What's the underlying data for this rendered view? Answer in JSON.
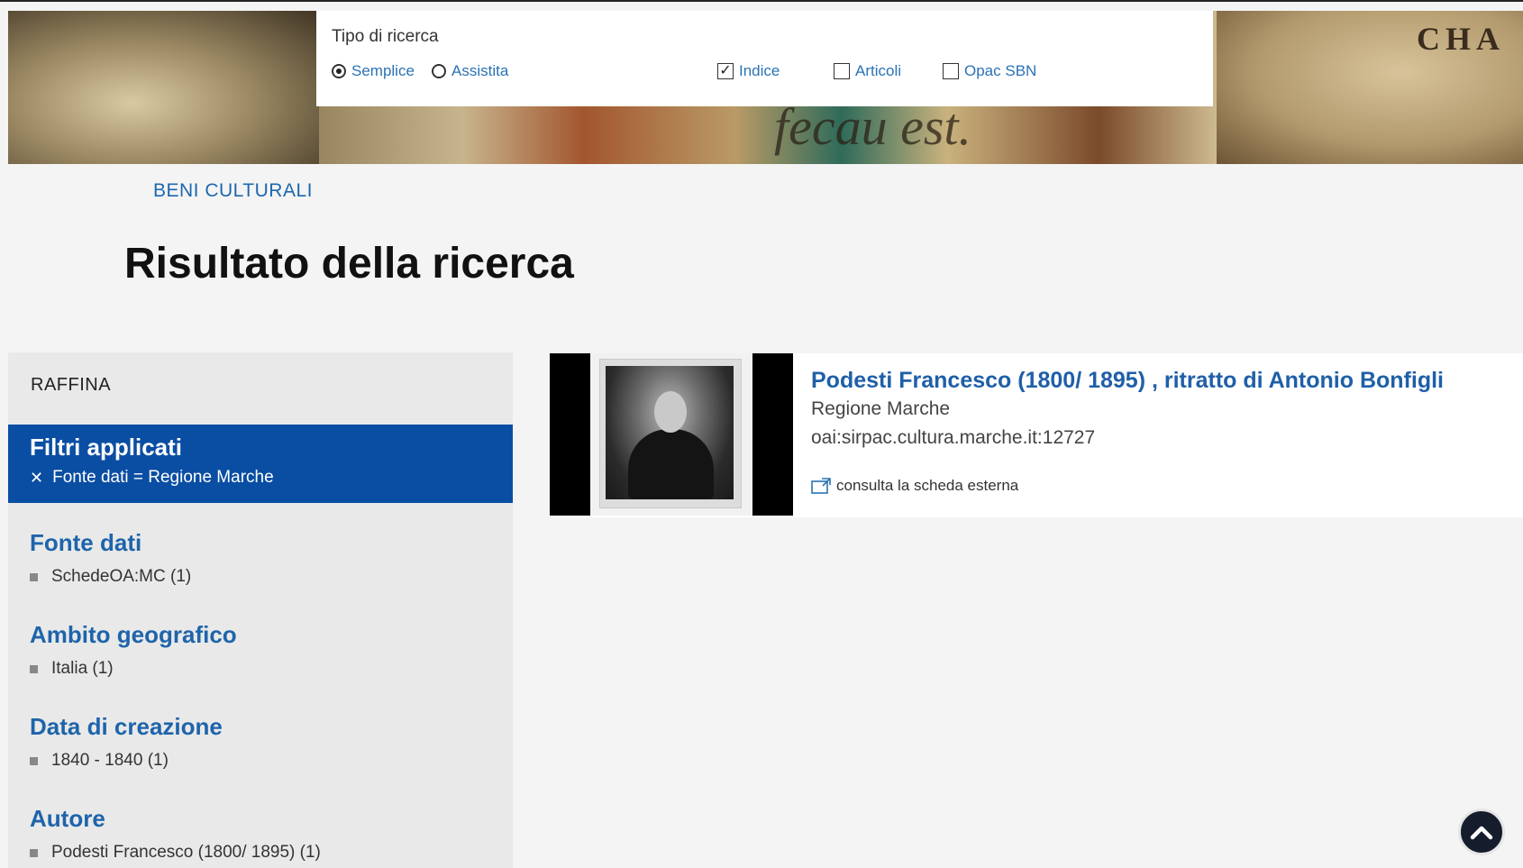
{
  "search": {
    "tipo_label": "Tipo di ricerca",
    "options": {
      "semplice": "Semplice",
      "assistita": "Assistita",
      "indice": "Indice",
      "articoli": "Articoli",
      "opac": "Opac SBN"
    },
    "selected_mode": "Semplice",
    "checked": [
      "Indice"
    ]
  },
  "banner": {
    "text_right": "CHA",
    "text_center": "fecau est."
  },
  "breadcrumb": "BENI CULTURALI",
  "page_title": "Risultato della ricerca",
  "sidebar": {
    "raffina": "RAFFINA",
    "filters_title": "Filtri applicati",
    "filter_item": "Fonte dati = Regione Marche",
    "facets": [
      {
        "heading": "Fonte dati",
        "item": "SchedeOA:MC (1)"
      },
      {
        "heading": "Ambito geografico",
        "item": "Italia (1)"
      },
      {
        "heading": "Data di creazione",
        "item": "1840 - 1840 (1)"
      },
      {
        "heading": "Autore",
        "item": "Podesti Francesco (1800/ 1895) (1)"
      }
    ]
  },
  "result": {
    "title": "Podesti Francesco (1800/ 1895) , ritratto di Antonio Bonfigli",
    "source": "Regione Marche",
    "identifier": "oai:sirpac.cultura.marche.it:12727",
    "link_label": "consulta la scheda esterna"
  },
  "colors": {
    "accent": "#0a4ea3",
    "link": "#1e64ab",
    "sidebar_bg": "#e9e9e9"
  }
}
